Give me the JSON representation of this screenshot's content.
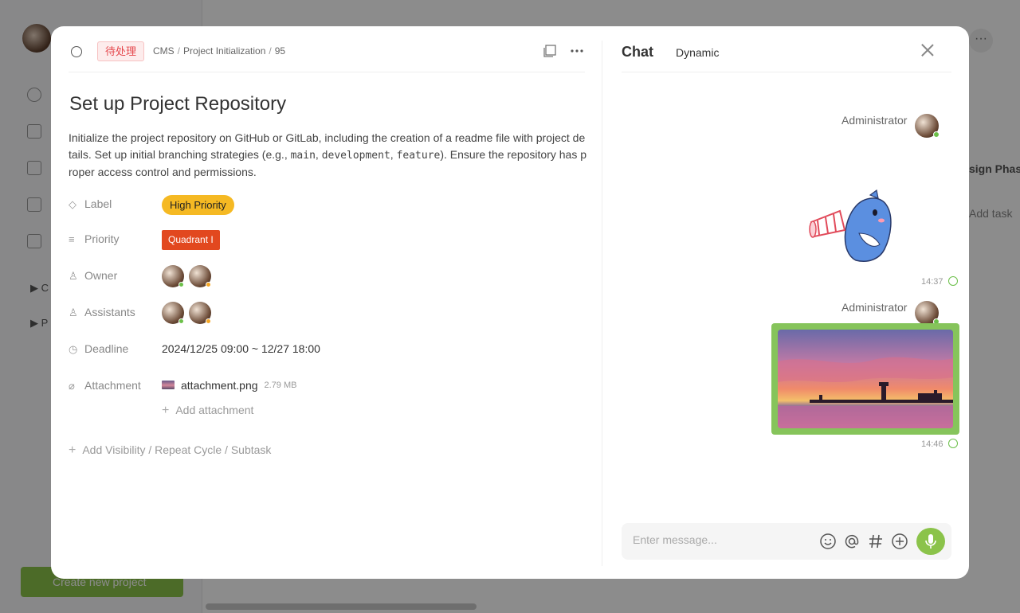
{
  "background": {
    "sidebar_tree": [
      "C",
      "P"
    ],
    "create_button_label": "Create new project",
    "column_title": "sign Phas",
    "add_task_label": "Add task",
    "more_label": "···"
  },
  "task": {
    "status_tag": "待处理",
    "breadcrumb": [
      "CMS",
      "Project Initialization",
      "95"
    ],
    "title": "Set up Project Repository",
    "description_parts": {
      "p1": "Initialize the project repository on GitHub or GitLab, including the creation of a readme file with project details. Set up initial branching strategies (e.g., ",
      "c1": "main",
      "p2": ", ",
      "c2": "development",
      "p3": ", ",
      "c3": "feature",
      "p4": "). Ensure the repository has proper access control and permissions."
    },
    "fields": {
      "label": {
        "name": "Label",
        "value": "High Priority",
        "color": "#f5b923"
      },
      "priority": {
        "name": "Priority",
        "value": "Quadrant I",
        "color": "#e2481f"
      },
      "owner": {
        "name": "Owner",
        "avatars": [
          {
            "status_color": "#6cc04a"
          },
          {
            "status_color": "#f5a623"
          }
        ]
      },
      "assistants": {
        "name": "Assistants",
        "avatars": [
          {
            "status_color": "#6cc04a"
          },
          {
            "status_color": "#f5a623"
          }
        ]
      },
      "deadline": {
        "name": "Deadline",
        "value": "2024/12/25 09:00 ~ 12/27 18:00"
      },
      "attachment": {
        "name": "Attachment",
        "file_name": "attachment.png",
        "file_size": "2.79 MB",
        "add_label": "Add attachment"
      }
    },
    "add_more_label": "Add Visibility / Repeat Cycle / Subtask"
  },
  "chat": {
    "tabs": {
      "chat": "Chat",
      "dynamic": "Dynamic"
    },
    "messages": [
      {
        "author": "Administrator",
        "type": "sticker",
        "time": "14:37"
      },
      {
        "author": "Administrator",
        "type": "image",
        "time": "14:46"
      }
    ],
    "input_placeholder": "Enter message...",
    "accent_color": "#8bc34a"
  }
}
